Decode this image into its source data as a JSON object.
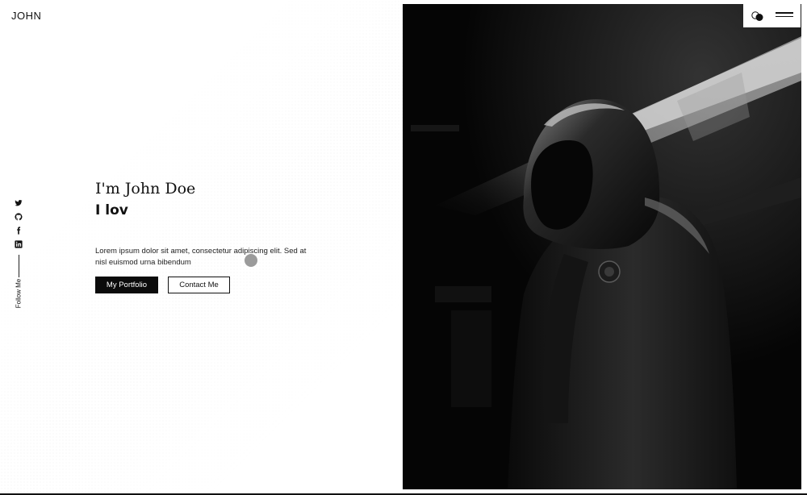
{
  "header": {
    "logo": "JOHN"
  },
  "social": {
    "icons": [
      "twitter-icon",
      "github-icon",
      "facebook-icon",
      "linkedin-icon"
    ],
    "follow_label": "Follow Me"
  },
  "hero": {
    "greeting": "I'm John Doe",
    "typed_text": "I lov",
    "description": "Lorem ipsum dolor sit amet, consectetur adipiscing elit. Sed at nisl euismod urna bibendum",
    "primary_button": "My Portfolio",
    "secondary_button": "Contact Me"
  },
  "colors": {
    "background": "#ffffff",
    "text": "#111111",
    "button_dark": "#0b0b0b",
    "photo_bg": "#050505"
  }
}
